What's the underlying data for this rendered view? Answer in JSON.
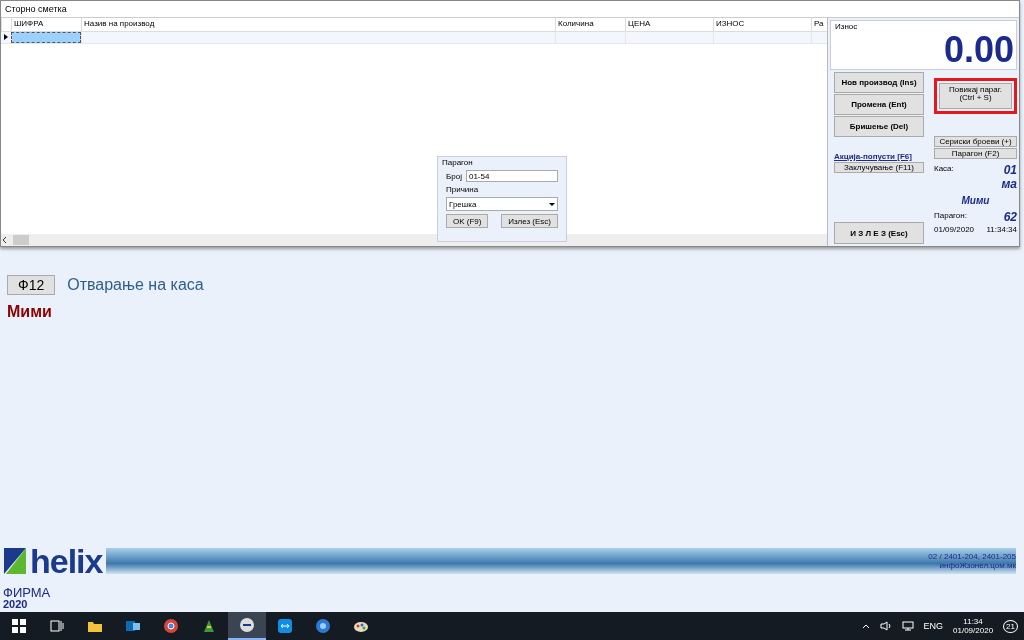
{
  "window": {
    "title": "Сторно сметка"
  },
  "table": {
    "columns": [
      "ШИФРА",
      "Назив на производ",
      "Количина",
      "ЦЕНА",
      "ИЗНОС",
      "Ра"
    ],
    "rows": [
      {
        "selected": true
      }
    ]
  },
  "amount": {
    "label": "Износ",
    "value": "0.00"
  },
  "actions": [
    "Нов производ (Ins)",
    "Промена (Ent)",
    "Бришење (Del)"
  ],
  "discount_link": "Акција-попусти [F6]",
  "lock_button": "Заклучување (F11)",
  "call_receipt_button": {
    "label": "Повикај параг.",
    "shortcut": "(Ctrl + S)",
    "highlighted": true
  },
  "serial_button": "Сериски броеви (+)",
  "receipt_button": "Парагон (F2)",
  "info": {
    "register_label": "Каса:",
    "register_value": "01",
    "register_code": "ма",
    "user": "Мими",
    "receipt_label": "Парагон:",
    "receipt_number": "62",
    "date": "01/09/2020",
    "time": "11:34:34"
  },
  "exit_button": "И З Л Е З (Esc)",
  "dialog": {
    "title": "Парагон",
    "number_label": "Број",
    "number_value": "01-54",
    "reason_label": "Причина",
    "reason_value": "Грешка",
    "buttons": [
      "OK (F9)",
      "Излез (Esc)"
    ]
  },
  "background": {
    "key": "Ф12",
    "action": "Отварање на каса",
    "user": "Мими"
  },
  "footer": {
    "logo": "helix",
    "contact": [
      "02 / 2401-204,  2401-205",
      "инфоЖзонел.цом.мк"
    ],
    "company": "ФИРМА",
    "year": "2020"
  },
  "taskbar": {
    "apps": [
      {
        "kind": "start",
        "selected": false
      },
      {
        "kind": "taskview",
        "selected": false
      },
      {
        "kind": "folder",
        "selected": false
      },
      {
        "kind": "mail",
        "selected": false
      },
      {
        "kind": "browser",
        "selected": false
      },
      {
        "kind": "tool",
        "selected": false
      },
      {
        "kind": "helix",
        "selected": true
      },
      {
        "kind": "remote",
        "selected": false
      },
      {
        "kind": "help",
        "selected": false
      },
      {
        "kind": "paint",
        "selected": false
      }
    ],
    "lang": "ENG",
    "time": "11:34",
    "date": "01/09/2020",
    "notifications": "21"
  }
}
